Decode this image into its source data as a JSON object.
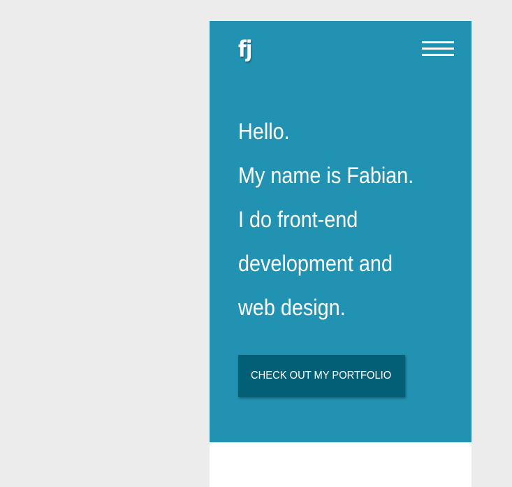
{
  "header": {
    "logo_text": "fj",
    "menu_icon": "hamburger-menu-icon"
  },
  "hero": {
    "lines": [
      "Hello.",
      "My name is Fabian.",
      "I do front-end",
      "development and",
      "web design."
    ],
    "cta_label": "CHECK OUT MY PORTFOLIO"
  },
  "colors": {
    "page_background": "#ececec",
    "hero_background": "#2192b1",
    "cta_background": "#035f75",
    "text": "#ffffff"
  }
}
